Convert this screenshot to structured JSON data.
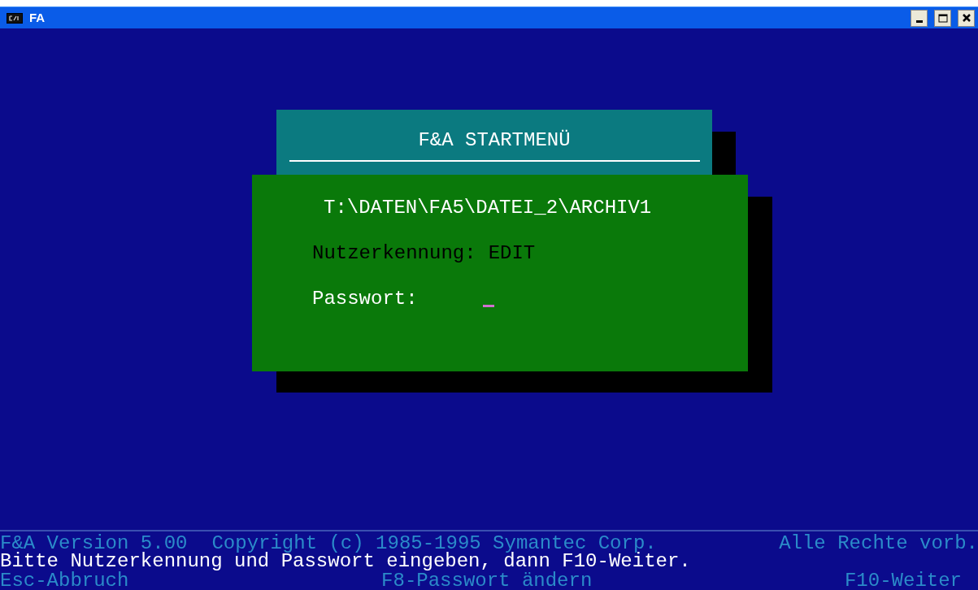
{
  "window": {
    "title": "FA"
  },
  "dialog": {
    "title": "F&A STARTMENÜ",
    "path": "T:\\DATEN\\FA5\\DATEI_2\\ARCHIV1",
    "fields": [
      {
        "kind": "text",
        "label": "Nutzerkennung:",
        "value": "EDIT"
      },
      {
        "kind": "password",
        "label": "Passwort:"
      }
    ]
  },
  "status_bar": {
    "version": "F&A Version 5.00",
    "copyright": "Copyright (c) 1985-1995 Symantec Corp.",
    "rights": "Alle Rechte vorb.",
    "message": "Bitte Nutzerkennung und Passwort eingeben, dann F10-Weiter.",
    "keys": [
      "Esc-Abbruch",
      "F8-Passwort ändern",
      "F10-Weiter"
    ]
  }
}
